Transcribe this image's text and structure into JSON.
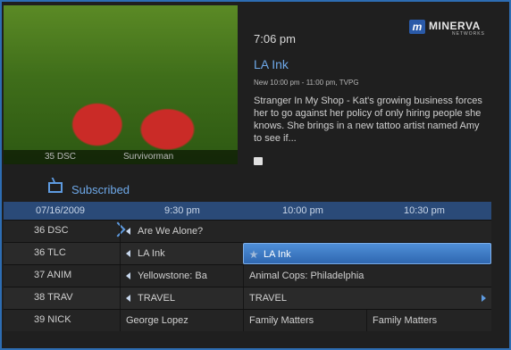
{
  "preview": {
    "channel": "35 DSC",
    "program": "Survivorman"
  },
  "info": {
    "time": "7:06 pm",
    "logo_main": "MINERVA",
    "logo_sub": "NETWORKS",
    "title": "LA Ink",
    "meta": "New 10:00 pm - 11:00 pm, TVPG",
    "description": "Stranger In My Shop - Kat's growing business forces her to go against her policy of only hiring people she knows. She brings in a new tattoo artist named Amy to see if..."
  },
  "filter": {
    "label": "Subscribed"
  },
  "guide": {
    "date": "07/16/2009",
    "times": [
      "9:30 pm",
      "10:00 pm",
      "10:30 pm"
    ],
    "rows": [
      {
        "channel": "36 DSC",
        "cells": [
          "Are We Alone?"
        ]
      },
      {
        "channel": "36 TLC",
        "cells": [
          "LA Ink",
          "LA Ink"
        ]
      },
      {
        "channel": "37 ANIM",
        "cells": [
          "Yellowstone: Ba",
          "Animal Cops: Philadelphia"
        ]
      },
      {
        "channel": "38 TRAV",
        "cells": [
          "TRAVEL",
          "TRAVEL"
        ]
      },
      {
        "channel": "39 NICK",
        "cells": [
          "George Lopez",
          "Family Matters",
          "Family Matters"
        ]
      }
    ]
  }
}
